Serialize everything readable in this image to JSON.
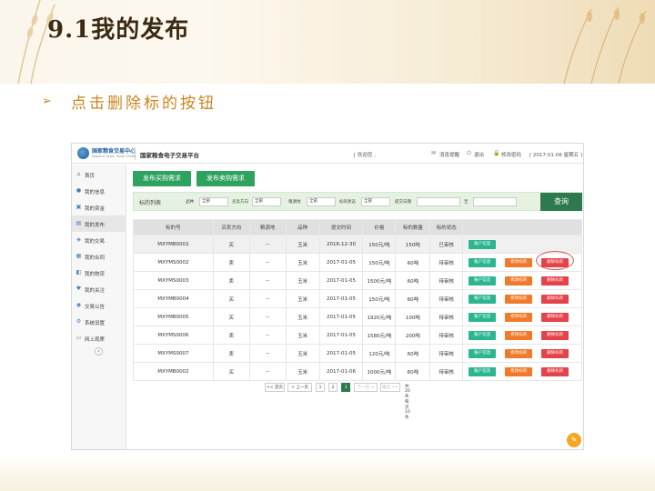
{
  "slide": {
    "title": "9.1我的发布",
    "bullet_marker": "➢",
    "bullet_text": "点击删除标的按钮"
  },
  "app": {
    "logo_text": "国家粮食交易中心",
    "logo_sub": "National Grain Trade Center",
    "platform_name": "国家粮食电子交易平台",
    "welcome": "[ 欢迎您 ,",
    "header_links": [
      {
        "label": "消息提醒",
        "icon": "mail-icon"
      },
      {
        "label": "退出",
        "icon": "power-icon"
      },
      {
        "label": "修改密码",
        "icon": "lock-icon"
      }
    ],
    "date": "[ 2017-01-06 星期五 ]",
    "sidebar": [
      {
        "label": "首页",
        "icon": "home-icon"
      },
      {
        "label": "我的信息",
        "icon": "user-icon"
      },
      {
        "label": "我的资金",
        "icon": "wallet-icon"
      },
      {
        "label": "我的发布",
        "icon": "publish-icon",
        "active": true
      },
      {
        "label": "我的交易",
        "icon": "trade-icon"
      },
      {
        "label": "我的合同",
        "icon": "contract-icon"
      },
      {
        "label": "我的物流",
        "icon": "truck-icon"
      },
      {
        "label": "我的关注",
        "icon": "heart-icon"
      },
      {
        "label": "交易公告",
        "icon": "notice-icon"
      },
      {
        "label": "系统设置",
        "icon": "gear-icon"
      },
      {
        "label": "网上观摩",
        "icon": "monitor-icon"
      }
    ],
    "buttons": {
      "publish_buy": "发布买购需求",
      "publish_sell": "发布卖购需求"
    },
    "filter": {
      "title": "标的列表",
      "fields": [
        {
          "label": "品种",
          "value": "全部"
        },
        {
          "label": "买卖方向",
          "value": "全部"
        },
        {
          "label": "粮源地",
          "value": "全部"
        },
        {
          "label": "标的状态",
          "value": "全部"
        },
        {
          "label": "提交日期",
          "value": ""
        },
        {
          "label": "至",
          "value": ""
        }
      ],
      "search_label": "查询"
    },
    "table": {
      "headers": [
        "标的号",
        "买卖方向",
        "粮源地",
        "品种",
        "提交时间",
        "价格",
        "标的数量",
        "标的状态",
        ""
      ],
      "rows": [
        {
          "id": "MXYMB0002",
          "dir": "买",
          "origin": "--",
          "variety": "玉米",
          "date": "2016-12-30",
          "price": "150元/吨",
          "qty": "150吨",
          "status": "已审核",
          "actions": [
            "账户信息"
          ]
        },
        {
          "id": "MXYMS0002",
          "dir": "卖",
          "origin": "--",
          "variety": "玉米",
          "date": "2017-01-05",
          "price": "150元/吨",
          "qty": "60吨",
          "status": "待审核",
          "actions": [
            "账户信息",
            "修改标的",
            "删除标的"
          ]
        },
        {
          "id": "MXYMS0003",
          "dir": "卖",
          "origin": "--",
          "variety": "玉米",
          "date": "2017-01-05",
          "price": "1500元/吨",
          "qty": "60吨",
          "status": "待审核",
          "actions": [
            "账户信息",
            "修改标的",
            "删除标的"
          ]
        },
        {
          "id": "MXYMB0004",
          "dir": "买",
          "origin": "--",
          "variety": "玉米",
          "date": "2017-01-05",
          "price": "150元/吨",
          "qty": "60吨",
          "status": "待审核",
          "actions": [
            "账户信息",
            "修改标的",
            "删除标的"
          ]
        },
        {
          "id": "MXYMB0005",
          "dir": "买",
          "origin": "--",
          "variety": "玉米",
          "date": "2017-01-05",
          "price": "1920元/吨",
          "qty": "100吨",
          "status": "待审核",
          "actions": [
            "账户信息",
            "修改标的",
            "删除标的"
          ]
        },
        {
          "id": "MXYMS0006",
          "dir": "卖",
          "origin": "--",
          "variety": "玉米",
          "date": "2017-01-05",
          "price": "1580元/吨",
          "qty": "200吨",
          "status": "待审核",
          "actions": [
            "账户信息",
            "修改标的",
            "删除标的"
          ]
        },
        {
          "id": "MXYMS0007",
          "dir": "卖",
          "origin": "--",
          "variety": "玉米",
          "date": "2017-01-05",
          "price": "120元/吨",
          "qty": "60吨",
          "status": "待审核",
          "actions": [
            "账户信息",
            "修改标的",
            "删除标的"
          ]
        },
        {
          "id": "MXYMB0002",
          "dir": "买",
          "origin": "--",
          "variety": "玉米",
          "date": "2017-01-06",
          "price": "1000元/吨",
          "qty": "60吨",
          "status": "待审核",
          "actions": [
            "账户信息",
            "修改标的",
            "删除标的"
          ]
        }
      ]
    },
    "pager": {
      "first": "<< 首页",
      "prev": "< 上一页",
      "pages": [
        "1",
        "2",
        "3"
      ],
      "current": "3",
      "next": "下一页 >",
      "last": "尾页 >>",
      "info": "共20条 每页10条"
    },
    "colors": {
      "green": "#2ea25f",
      "dark_green": "#2d7a4e",
      "info": "#2bb690",
      "edit": "#f07a2a",
      "delete": "#e5424a"
    }
  }
}
